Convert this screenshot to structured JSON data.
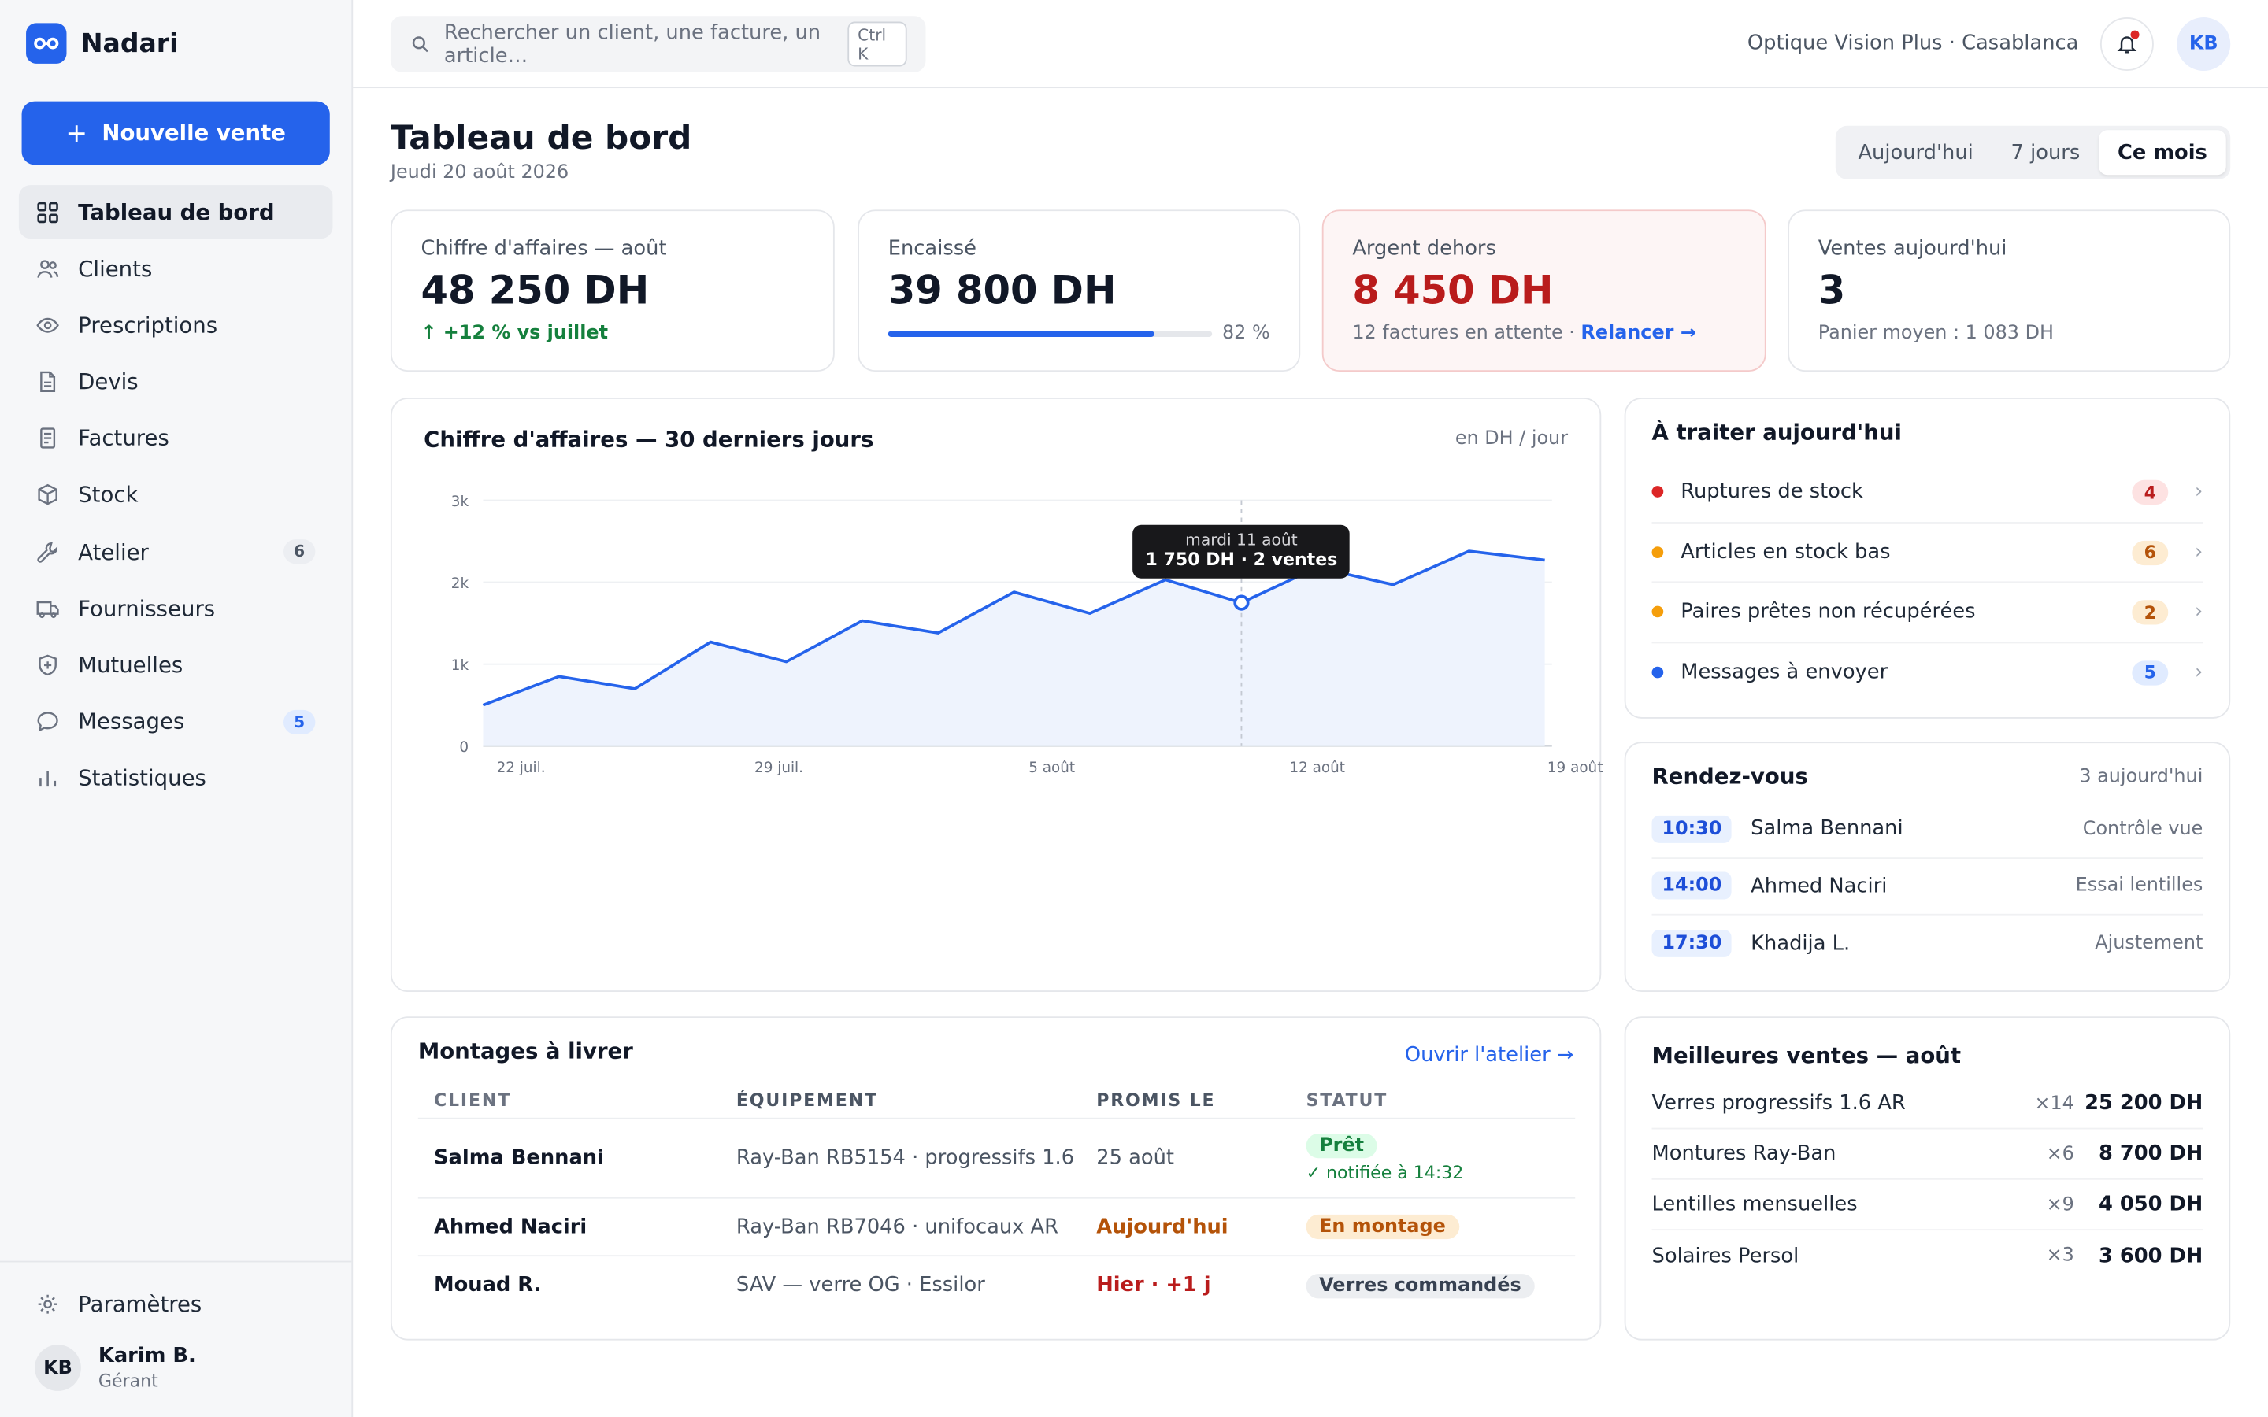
{
  "app": {
    "name": "Nadari"
  },
  "sidebar": {
    "new_sale": "Nouvelle vente",
    "items": [
      {
        "label": "Tableau de bord",
        "icon": "grid-icon"
      },
      {
        "label": "Clients",
        "icon": "users-icon"
      },
      {
        "label": "Prescriptions",
        "icon": "eye-icon"
      },
      {
        "label": "Devis",
        "icon": "document-icon"
      },
      {
        "label": "Factures",
        "icon": "receipt-icon"
      },
      {
        "label": "Stock",
        "icon": "box-icon"
      },
      {
        "label": "Atelier",
        "icon": "wrench-icon",
        "badge": "6"
      },
      {
        "label": "Fournisseurs",
        "icon": "truck-icon"
      },
      {
        "label": "Mutuelles",
        "icon": "shield-icon"
      },
      {
        "label": "Messages",
        "icon": "chat-icon",
        "badge": "5"
      },
      {
        "label": "Statistiques",
        "icon": "bar-chart-icon"
      }
    ],
    "settings": "Paramètres",
    "user": {
      "initials": "KB",
      "name": "Karim B.",
      "role": "Gérant"
    }
  },
  "topbar": {
    "search_placeholder": "Rechercher un client, une facture, un article…",
    "shortcut": "Ctrl K",
    "shop": "Optique Vision Plus · Casablanca",
    "avatar": "KB"
  },
  "header": {
    "title": "Tableau de bord",
    "date": "Jeudi 20 août 2026",
    "periods": [
      "Aujourd'hui",
      "7 jours",
      "Ce mois"
    ],
    "active_period": "Ce mois"
  },
  "kpis": {
    "revenue": {
      "label": "Chiffre d'affaires — août",
      "value": "48 250 DH",
      "delta": "↑ +12 % vs juillet"
    },
    "collected": {
      "label": "Encaissé",
      "value": "39 800 DH",
      "percent": 82,
      "percent_label": "82 %"
    },
    "outstanding": {
      "label": "Argent dehors",
      "value": "8 450 DH",
      "sub": "12 factures en attente · ",
      "action": "Relancer →"
    },
    "sales_today": {
      "label": "Ventes aujourd'hui",
      "value": "3",
      "sub": "Panier moyen : 1 083 DH"
    }
  },
  "chart_data": {
    "type": "area",
    "title": "Chiffre d'affaires — 30 derniers jours",
    "unit_note": "en DH / jour",
    "ylim": [
      0,
      3000
    ],
    "yticks": [
      0,
      1000,
      2000,
      3000
    ],
    "ytick_labels": [
      "0",
      "1k",
      "2k",
      "3k"
    ],
    "xtick_labels": [
      "22 juil.",
      "29 juil.",
      "5 août",
      "12 août",
      "19 août"
    ],
    "x": [
      "21 juil.",
      "23 juil.",
      "25 juil.",
      "27 juil.",
      "29 juil.",
      "31 juil.",
      "2 août",
      "4 août",
      "6 août",
      "8 août",
      "10 août",
      "11 août",
      "13 août",
      "15 août",
      "17 août",
      "19 août"
    ],
    "values": [
      500,
      850,
      700,
      1270,
      1030,
      1530,
      1380,
      1880,
      1620,
      2030,
      1750,
      2180,
      1970,
      2380,
      2270
    ],
    "grid": true,
    "highlight": {
      "index": 10,
      "date": "mardi 11 août",
      "label": "1 750 DH · 2 ventes"
    }
  },
  "todo": {
    "title": "À traiter aujourd'hui",
    "items": [
      {
        "label": "Ruptures de stock",
        "count": "4",
        "color": "#dc2626",
        "badge_bg": "#fde2e2",
        "badge_fg": "#b91c1c"
      },
      {
        "label": "Articles en stock bas",
        "count": "6",
        "color": "#f59e0b",
        "badge_bg": "#fdecd2",
        "badge_fg": "#b45309"
      },
      {
        "label": "Paires prêtes non récupérées",
        "count": "2",
        "color": "#f59e0b",
        "badge_bg": "#fdecd2",
        "badge_fg": "#b45309"
      },
      {
        "label": "Messages à envoyer",
        "count": "5",
        "color": "#2563eb",
        "badge_bg": "#e0ebff",
        "badge_fg": "#2563eb"
      }
    ]
  },
  "rdv": {
    "title": "Rendez-vous",
    "meta": "3 aujourd'hui",
    "items": [
      {
        "time": "10:30",
        "name": "Salma Bennani",
        "type": "Contrôle vue"
      },
      {
        "time": "14:00",
        "name": "Ahmed Naciri",
        "type": "Essai lentilles"
      },
      {
        "time": "17:30",
        "name": "Khadija L.",
        "type": "Ajustement"
      }
    ]
  },
  "montages": {
    "title": "Montages à livrer",
    "link": "Ouvrir l'atelier →",
    "columns": [
      "CLIENT",
      "ÉQUIPEMENT",
      "PROMIS LE",
      "STATUT"
    ],
    "rows": [
      {
        "client": "Salma Bennani",
        "equip": "Ray-Ban RB5154 · progressifs 1.6",
        "due": "25 août",
        "status": "Prêt",
        "note": "✓ notifiée à 14:32"
      },
      {
        "client": "Ahmed Naciri",
        "equip": "Ray-Ban RB7046 · unifocaux AR",
        "due": "Aujourd'hui",
        "status": "En montage"
      },
      {
        "client": "Mouad R.",
        "equip": "SAV — verre OG · Essilor",
        "due": "Hier · +1 j",
        "status": "Verres commandés"
      }
    ]
  },
  "best": {
    "title": "Meilleures ventes — août",
    "items": [
      {
        "name": "Verres progressifs 1.6 AR",
        "qty": "×14",
        "amount": "25 200 DH"
      },
      {
        "name": "Montures Ray-Ban",
        "qty": "×6",
        "amount": "8 700 DH"
      },
      {
        "name": "Lentilles mensuelles",
        "qty": "×9",
        "amount": "4 050 DH"
      },
      {
        "name": "Solaires Persol",
        "qty": "×3",
        "amount": "3 600 DH"
      }
    ]
  }
}
